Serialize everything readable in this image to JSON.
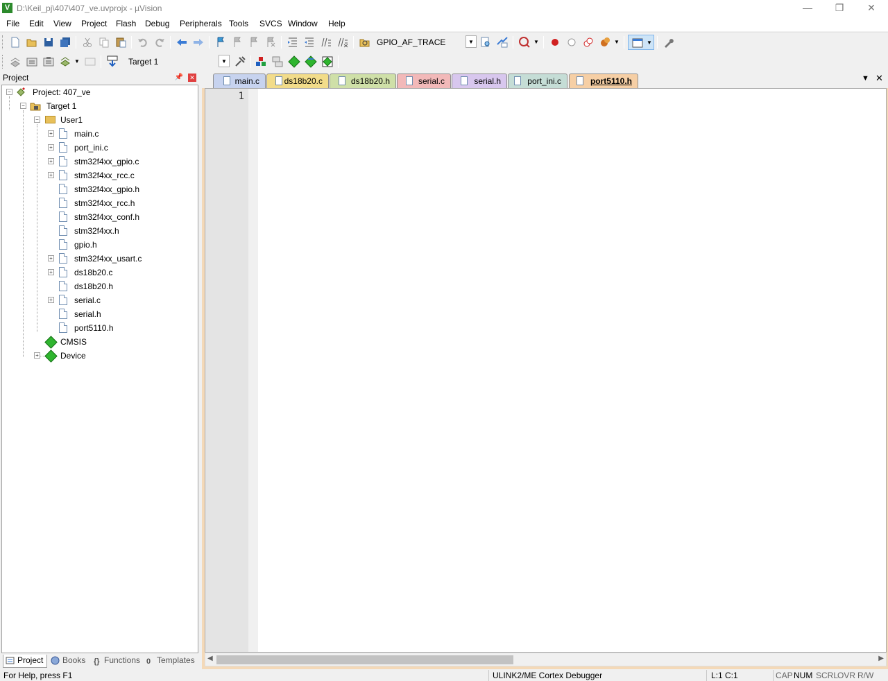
{
  "window": {
    "title": "D:\\Keil_pj\\407\\407_ve.uvprojx - µVision",
    "app_icon_letter": "V",
    "minimize": "—",
    "restore": "❐",
    "close": "✕"
  },
  "menu": [
    "File",
    "Edit",
    "View",
    "Project",
    "Flash",
    "Debug",
    "Peripherals",
    "Tools",
    "SVCS",
    "Window",
    "Help"
  ],
  "toolbar": {
    "find_combo": "GPIO_AF_TRACE",
    "target_combo": "Target 1"
  },
  "project_panel": {
    "title": "Project",
    "root": "Project: 407_ve",
    "target": "Target 1",
    "group": "User1",
    "files": [
      "main.c",
      "port_ini.c",
      "stm32f4xx_gpio.c",
      "stm32f4xx_rcc.c",
      "stm32f4xx_gpio.h",
      "stm32f4xx_rcc.h",
      "stm32f4xx_conf.h",
      "stm32f4xx.h",
      "gpio.h",
      "stm32f4xx_usart.c",
      "ds18b20.c",
      "ds18b20.h",
      "serial.c",
      "serial.h",
      "port5110.h"
    ],
    "cmsis": "CMSIS",
    "device": "Device",
    "bottom_tabs": [
      "Project",
      "Books",
      "Functions",
      "Templates"
    ]
  },
  "editor": {
    "tabs": [
      {
        "label": "main.c",
        "color": "#c7d3ef"
      },
      {
        "label": "ds18b20.c",
        "color": "#f2dc8a"
      },
      {
        "label": "ds18b20.h",
        "color": "#cfe0a8"
      },
      {
        "label": "serial.c",
        "color": "#f2b9b9"
      },
      {
        "label": "serial.h",
        "color": "#d8c7ee"
      },
      {
        "label": "port_ini.c",
        "color": "#c5ddd6"
      },
      {
        "label": "port5110.h",
        "color": "#f6cfa5"
      }
    ],
    "line_number": "1"
  },
  "status": {
    "help": "For Help, press F1",
    "debugger": "ULINK2/ME Cortex Debugger",
    "position": "L:1 C:1",
    "cap": "CAP",
    "num": "NUM",
    "scrl": "SCRL",
    "ovr": "OVR",
    "rw": "R/W"
  }
}
